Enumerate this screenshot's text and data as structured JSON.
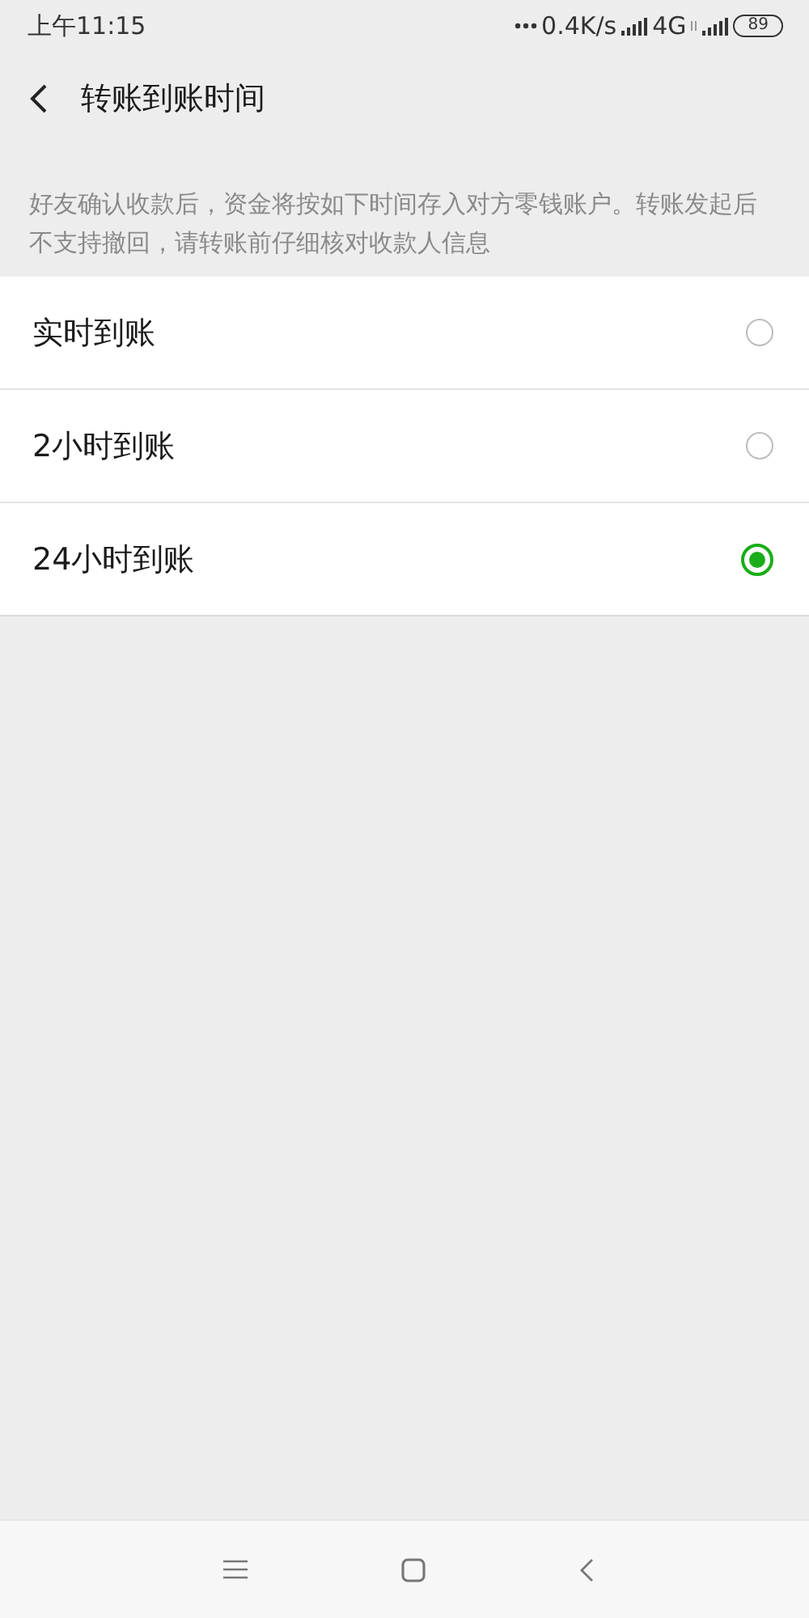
{
  "status_bar": {
    "time": "上午11:15",
    "speed": "0.4K/s",
    "network": "4G",
    "battery": "89"
  },
  "header": {
    "title": "转账到账时间"
  },
  "note": "好友确认收款后，资金将按如下时间存入对方零钱账户。转账发起后不支持撤回，请转账前仔细核对收款人信息",
  "options": [
    {
      "label": "实时到账",
      "selected": false
    },
    {
      "label": "2小时到账",
      "selected": false
    },
    {
      "label": "24小时到账",
      "selected": true
    }
  ]
}
